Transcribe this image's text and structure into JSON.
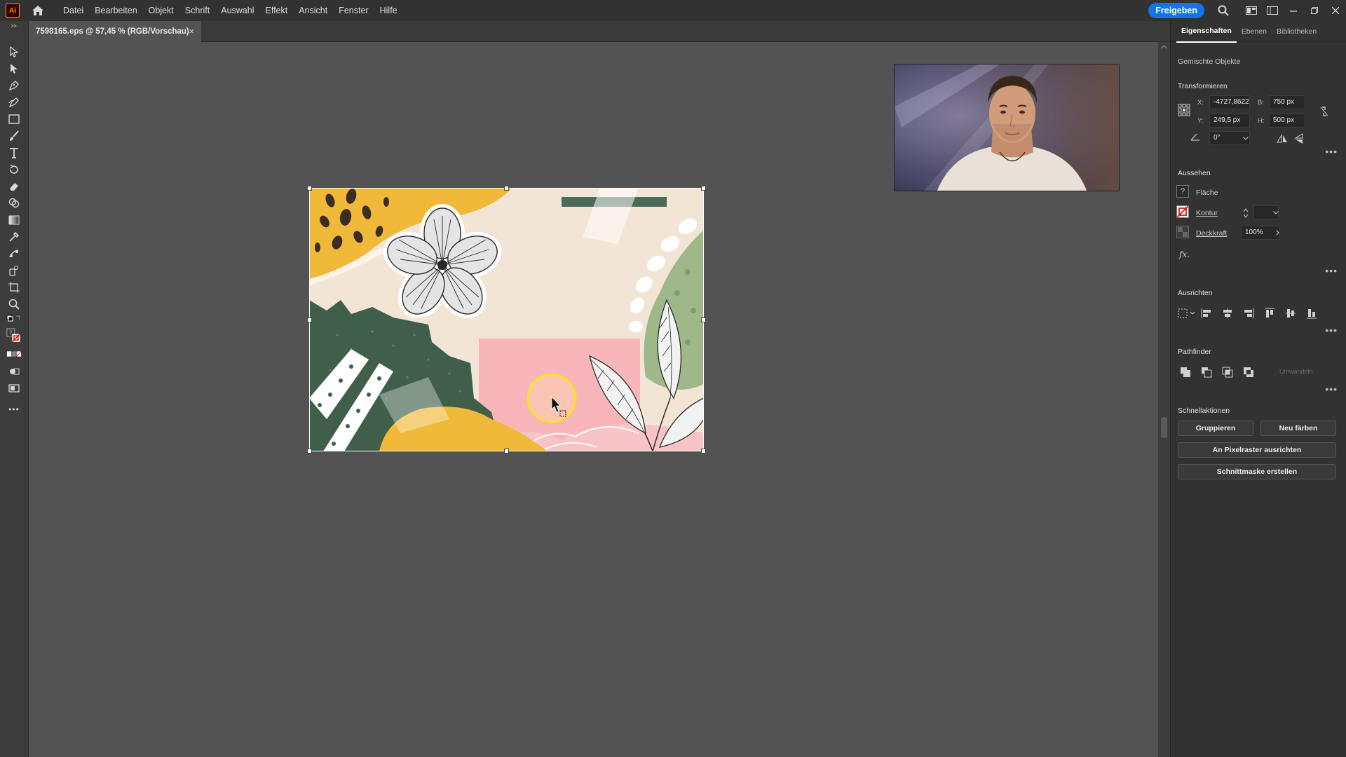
{
  "app": {
    "logo_text": "Ai",
    "menu": [
      "Datei",
      "Bearbeiten",
      "Objekt",
      "Schrift",
      "Auswahl",
      "Effekt",
      "Ansicht",
      "Fenster",
      "Hilfe"
    ],
    "share_label": "Freigeben"
  },
  "document": {
    "tab_title": "7598165.eps @ 57,45 % (RGB/Vorschau)",
    "close_glyph": "×"
  },
  "panel": {
    "tabs": [
      "Eigenschaften",
      "Ebenen",
      "Bibliotheken"
    ],
    "active_tab": "Eigenschaften",
    "selection_type": "Gemischte Objekte",
    "transform": {
      "title": "Transformieren",
      "x_label": "X:",
      "x_value": "-4727,8622",
      "y_label": "Y:",
      "y_value": "249,5 px",
      "w_label": "B:",
      "w_value": "750 px",
      "h_label": "H:",
      "h_value": "500 px",
      "angle_value": "0°"
    },
    "appearance": {
      "title": "Aussehen",
      "fill_label": "Fläche",
      "fill_glyph": "?",
      "stroke_label": "Kontur",
      "opacity_label": "Deckkraft",
      "opacity_value": "100%",
      "fx_label": "fx."
    },
    "align": {
      "title": "Ausrichten"
    },
    "pathfinder": {
      "title": "Pathfinder",
      "expand_label": "Umwandeln"
    },
    "quick_actions": {
      "title": "Schnellaktionen",
      "group": "Gruppieren",
      "recolor": "Neu färben",
      "pixel_align": "An Pixelraster ausrichten",
      "clip_mask": "Schnittmaske erstellen"
    },
    "more_glyph": "•••"
  },
  "colors": {
    "accent": "#1473e6",
    "chrome_dark": "#323232",
    "canvas": "#535353",
    "art_yellow": "#f0b93a",
    "art_green": "#3f5f4b",
    "art_pink": "#f8b6ba",
    "art_cream": "#f3e5d5",
    "art_sage": "#9fb88a",
    "cursor_ring": "#ffe600"
  }
}
